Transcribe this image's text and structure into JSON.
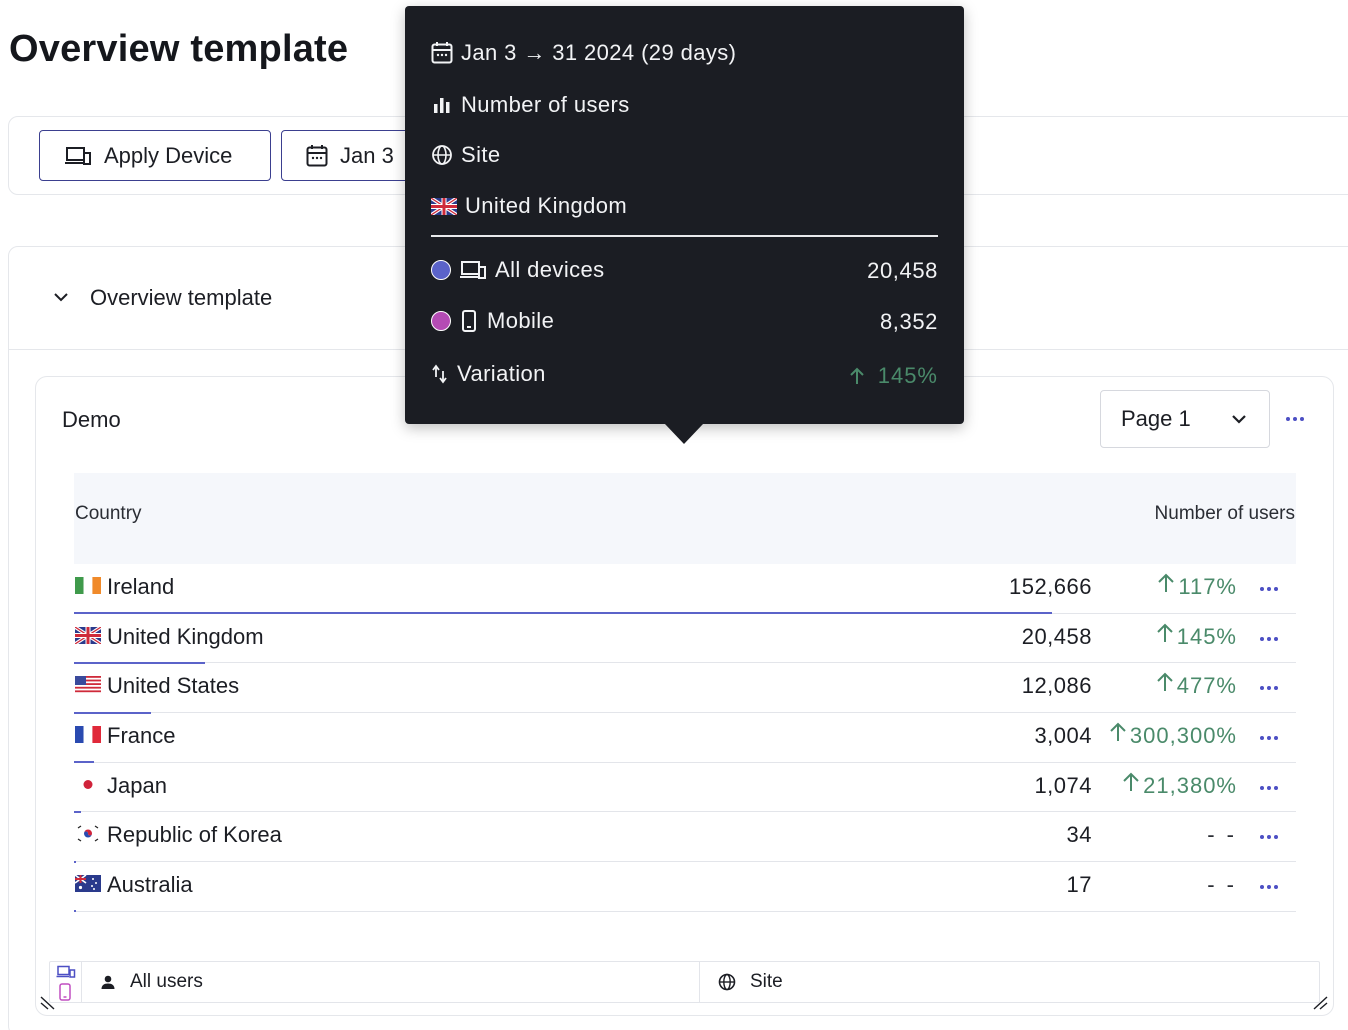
{
  "page": {
    "title": "Overview template"
  },
  "toolbar": {
    "apply_device_label": "Apply Device",
    "date_label": "Jan 3"
  },
  "section": {
    "title": "Overview template"
  },
  "widget": {
    "title": "Demo",
    "page_select": "Page 1",
    "columns": {
      "country": "Country",
      "users": "Number of users"
    },
    "rows": [
      {
        "country": "Ireland",
        "flag": "ireland-flag-icon",
        "value": "152,666",
        "variation": "117%",
        "share": 0.8
      },
      {
        "country": "United Kingdom",
        "flag": "uk-flag-icon",
        "value": "20,458",
        "variation": "145%",
        "share": 0.107
      },
      {
        "country": "United States",
        "flag": "us-flag-icon",
        "value": "12,086",
        "variation": "477%",
        "share": 0.063
      },
      {
        "country": "France",
        "flag": "france-flag-icon",
        "value": "3,004",
        "variation": "300,300%",
        "share": 0.016
      },
      {
        "country": "Japan",
        "flag": "japan-flag-icon",
        "value": "1,074",
        "variation": "21,380%",
        "share": 0.0055
      },
      {
        "country": "Republic of Korea",
        "flag": "korea-flag-icon",
        "value": "34",
        "variation": "- -",
        "share": 0.001
      },
      {
        "country": "Australia",
        "flag": "australia-flag-icon",
        "value": "17",
        "variation": "- -",
        "share": 0.001
      }
    ],
    "footer": {
      "segment": "All users",
      "scope": "Site"
    }
  },
  "tooltip": {
    "date_range": "Jan 3 → 31 2024 (29 days)",
    "metric": "Number of users",
    "scope": "Site",
    "country": "United Kingdom",
    "series": [
      {
        "label": "All devices",
        "value": "20,458",
        "color": "#5b63c9"
      },
      {
        "label": "Mobile",
        "value": "8,352",
        "color": "#b44bb4"
      }
    ],
    "variation_label": "Variation",
    "variation_value": "145%",
    "variation_color": "#4a8a6a"
  }
}
